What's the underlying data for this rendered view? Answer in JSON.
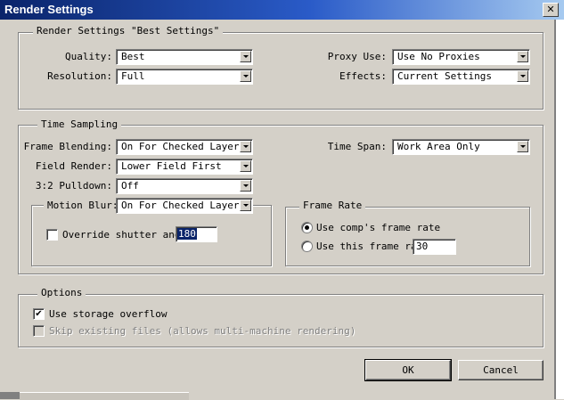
{
  "window": {
    "title": "Render Settings",
    "close_glyph": "✕"
  },
  "render_settings": {
    "legend": "Render Settings \"Best Settings\"",
    "quality": {
      "label": "Quality:",
      "value": "Best"
    },
    "resolution": {
      "label": "Resolution:",
      "value": "Full"
    },
    "proxy_use": {
      "label": "Proxy Use:",
      "value": "Use No Proxies"
    },
    "effects": {
      "label": "Effects:",
      "value": "Current Settings"
    }
  },
  "time_sampling": {
    "legend": "Time Sampling",
    "frame_blending": {
      "label": "Frame Blending:",
      "value": "On For Checked Layers"
    },
    "field_render": {
      "label": "Field Render:",
      "value": "Lower Field First"
    },
    "pulldown": {
      "label": "3:2 Pulldown:",
      "value": "Off"
    },
    "motion_blur": {
      "label": "Motion Blur:",
      "value": "On For Checked Layers",
      "override_label": "Override shutter angl",
      "override_checked": false,
      "shutter_value": "180"
    },
    "time_span": {
      "label": "Time Span:",
      "value": "Work Area Only"
    },
    "frame_rate": {
      "legend": "Frame Rate",
      "option_comp": "Use comp's frame rate",
      "option_this": "Use this frame rat",
      "selected": "comp",
      "rate_value": "30"
    }
  },
  "options": {
    "legend": "Options",
    "storage_overflow": {
      "label": "Use storage overflow",
      "checked": true,
      "check_glyph": "✔"
    },
    "skip_existing": {
      "label": "Skip existing files (allows multi-machine rendering)",
      "checked": false,
      "enabled": false
    }
  },
  "buttons": {
    "ok": "OK",
    "cancel": "Cancel"
  }
}
